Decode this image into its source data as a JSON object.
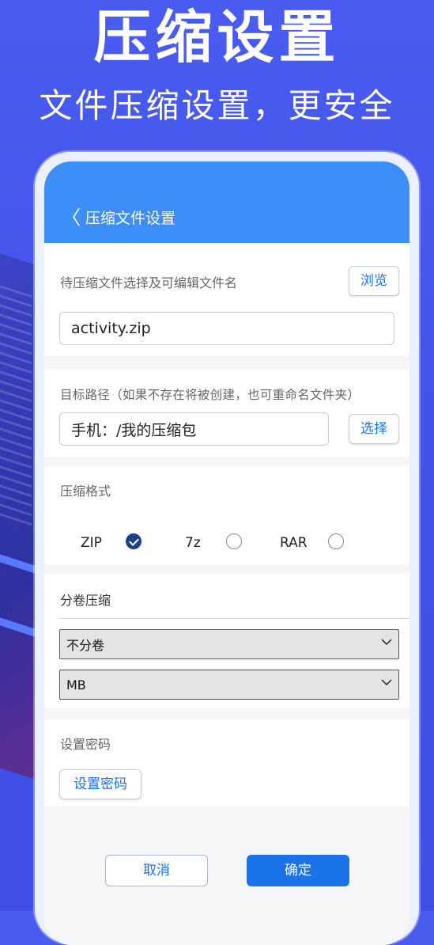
{
  "hero": {
    "title": "压缩设置",
    "subtitle": "文件压缩设置，更安全"
  },
  "appbar": {
    "back_icon": "chevron-left-icon",
    "back_glyph": "〈",
    "title": "压缩文件设置"
  },
  "file_section": {
    "label": "待压缩文件选择及可编辑文件名",
    "browse_label": "浏览",
    "filename_value": "activity.zip"
  },
  "target_section": {
    "label": "目标路径（如果不存在将被创建，也可重命名文件夹）",
    "path_value": "手机：/我的压缩包",
    "choose_label": "选择"
  },
  "format_section": {
    "label": "压缩格式",
    "options": [
      {
        "label": "ZIP",
        "checked": true
      },
      {
        "label": "7z",
        "checked": false
      },
      {
        "label": "RAR",
        "checked": false
      }
    ]
  },
  "split_section": {
    "label": "分卷压缩",
    "split_select_value": "不分卷",
    "unit_select_value": "MB"
  },
  "password_section": {
    "label": "设置密码",
    "button_label": "设置密码"
  },
  "actions": {
    "cancel_label": "取消",
    "ok_label": "确定"
  },
  "colors": {
    "background": "#4353ea",
    "appbar": "#3d8ef7",
    "accent": "#1a73e8",
    "radio_checked": "#1f3f8a"
  }
}
